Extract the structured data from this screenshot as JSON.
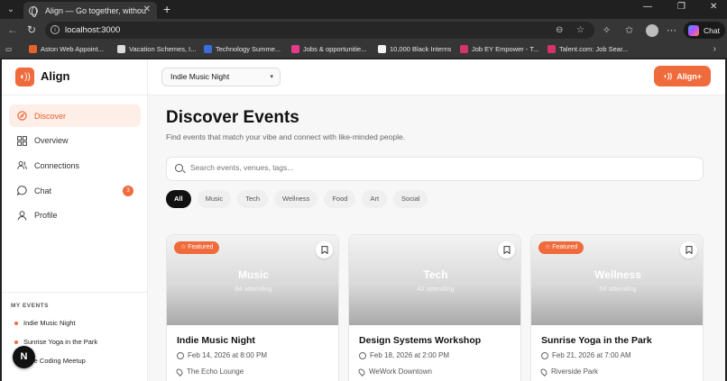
{
  "browser": {
    "tab_title": "Align — Go together, without the",
    "url": "localhost:3000",
    "copilot_label": "Chat",
    "bookmarks": [
      {
        "label": "Aston Web Appoint...",
        "color": "#e8602e"
      },
      {
        "label": "Vacation Schemes, I...",
        "color": "#dcdcdc"
      },
      {
        "label": "Technology Summe...",
        "color": "#3d6bd8"
      },
      {
        "label": "Jobs & opportunitie...",
        "color": "#e83a8a"
      },
      {
        "label": "10,000 Black Interns",
        "color": "#f2f2f2"
      },
      {
        "label": "Job EY Empower - T...",
        "color": "#d6336c"
      },
      {
        "label": "Talent.com: Job Sear...",
        "color": "#d6336c"
      }
    ]
  },
  "sidebar": {
    "brand": "Align",
    "nav": [
      {
        "label": "Discover",
        "icon": "compass-icon",
        "active": true
      },
      {
        "label": "Overview",
        "icon": "grid-icon",
        "active": false
      },
      {
        "label": "Connections",
        "icon": "users-icon",
        "active": false
      },
      {
        "label": "Chat",
        "icon": "chat-bubble-icon",
        "active": false,
        "badge": "3"
      },
      {
        "label": "Profile",
        "icon": "user-icon",
        "active": false
      }
    ],
    "my_events_title": "MY EVENTS",
    "my_events": [
      "Indie Music Night",
      "Sunrise Yoga in the Park",
      "ative Coding Meetup"
    ],
    "fab_label": "N"
  },
  "topbar": {
    "selected_event": "Indie Music Night",
    "align_plus_label": "Align+"
  },
  "main": {
    "title": "Discover Events",
    "subtitle": "Find events that match your vibe and connect with like-minded people.",
    "search_placeholder": "Search events, venues, tags...",
    "filters": [
      {
        "label": "All",
        "active": true
      },
      {
        "label": "Music",
        "active": false
      },
      {
        "label": "Tech",
        "active": false
      },
      {
        "label": "Wellness",
        "active": false
      },
      {
        "label": "Food",
        "active": false
      },
      {
        "label": "Art",
        "active": false
      },
      {
        "label": "Social",
        "active": false
      }
    ],
    "cards": [
      {
        "category": "Music",
        "attending": "84 attending",
        "featured": "Featured",
        "title": "Indie Music Night",
        "date": "Feb 14, 2026 at 8:00 PM",
        "venue": "The Echo Lounge"
      },
      {
        "category": "Tech",
        "attending": "42 attending",
        "featured": "",
        "title": "Design Systems Workshop",
        "date": "Feb 18, 2026 at 2:00 PM",
        "venue": "WeWork Downtown"
      },
      {
        "category": "Wellness",
        "attending": "56 attending",
        "featured": "Featured",
        "title": "Sunrise Yoga in the Park",
        "date": "Feb 21, 2026 at 7:00 AM",
        "venue": "Riverside Park"
      }
    ]
  },
  "colors": {
    "accent": "#f06b3c",
    "accent_soft": "#fdeee7",
    "chip_active": "#111111"
  }
}
